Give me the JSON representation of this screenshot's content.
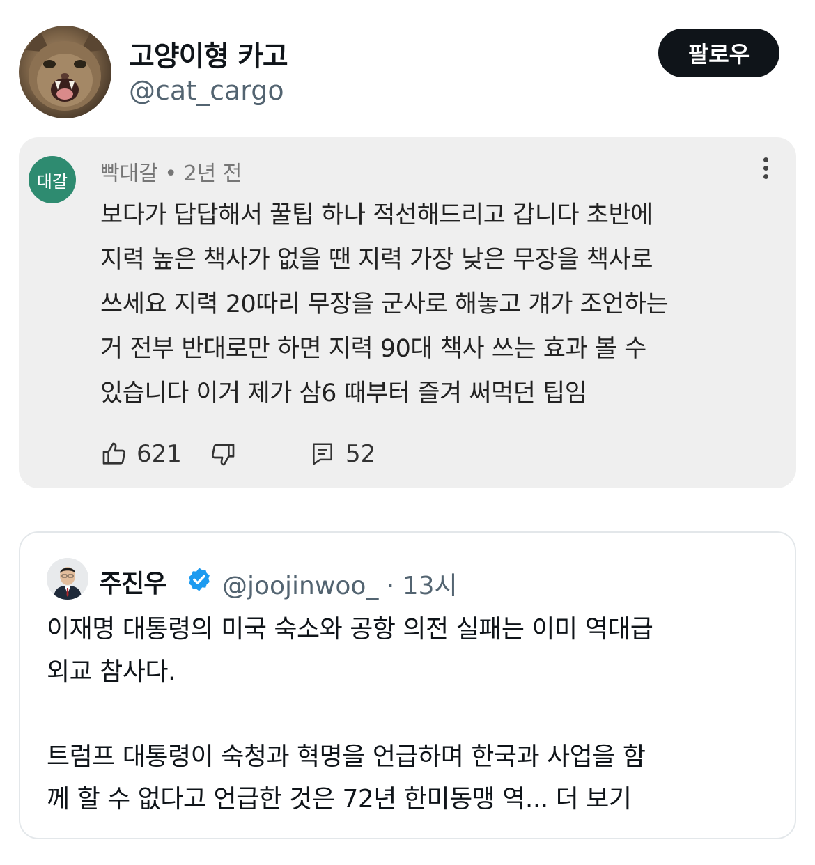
{
  "author": {
    "display_name": "고양이형 카고",
    "handle": "@cat_cargo",
    "avatar_icon": "cat-avatar"
  },
  "follow_label": "팔로우",
  "comment": {
    "avatar_text": "대갈",
    "avatar_color": "#2e8b70",
    "meta": "빡대갈 • 2년 전",
    "lines": [
      "보다가 답답해서 꿀팁 하나 적선해드리고 갑니다 초반에",
      "지력 높은 책사가 없을 땐 지력 가장 낮은 무장을 책사로",
      "쓰세요 지력 20따리 무장을 군사로 해놓고 걔가 조언하는",
      "거 전부 반대로만 하면 지력 90대 책사 쓰는 효과 볼 수",
      "있습니다 이거 제가 삼6 때부터 즐겨 써먹던 팁임"
    ],
    "like_count": "621",
    "reply_count": "52"
  },
  "quote": {
    "display_name": "주진우",
    "handle_time": "@joojinwoo_ · 13시",
    "verified_color": "#1d9bf0",
    "lines": [
      "이재명 대통령의 미국 숙소와 공항 의전 실패는 이미 역대급",
      "외교 참사다.",
      "",
      "트럼프 대통령이 숙청과 혁명을 언급하며 한국과 사업을 함",
      "께 할 수 없다고 언급한 것은 72년 한미동맹 역... "
    ],
    "more_label": "더 보기"
  }
}
